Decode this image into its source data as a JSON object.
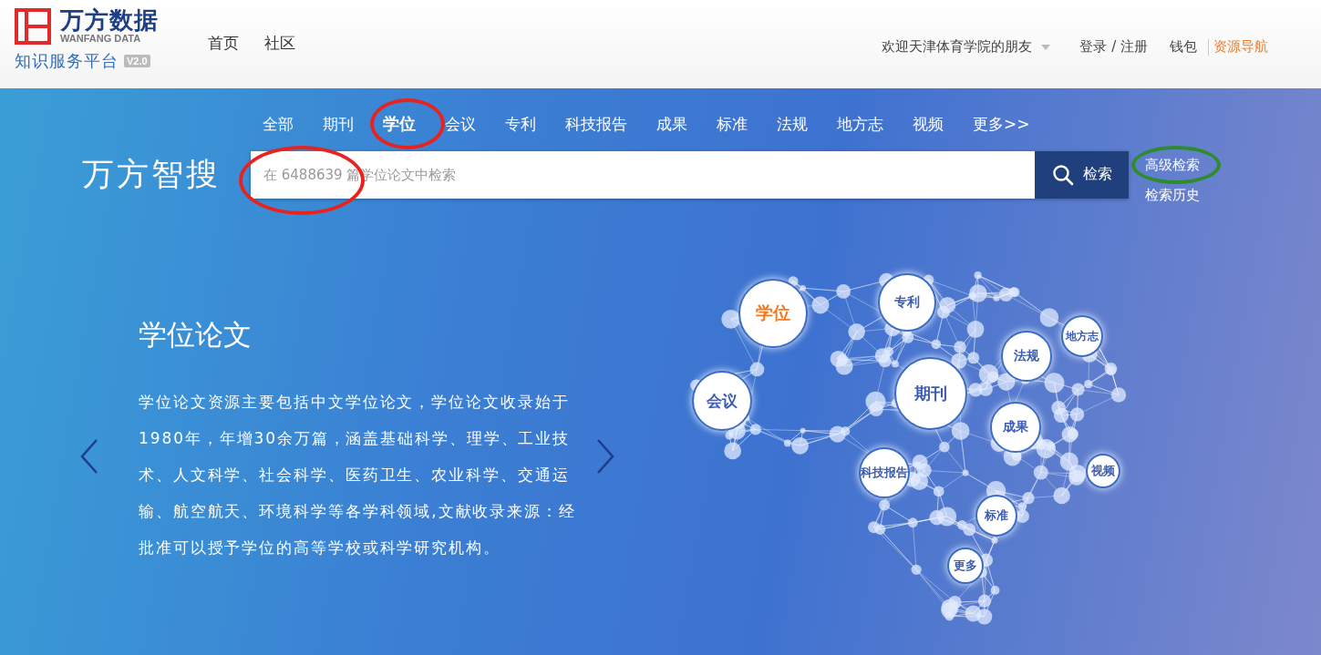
{
  "header": {
    "logo": {
      "brand": "万方数据",
      "brand_en": "WANFANG DATA",
      "platform": "知识服务平台",
      "version": "V2.0"
    },
    "nav": [
      "首页",
      "社区"
    ],
    "welcome": "欢迎天津体育学院的朋友",
    "login": "登录 / 注册",
    "wallet": "钱包",
    "resource_nav": "资源导航"
  },
  "tabs": [
    {
      "label": "全部",
      "selected": false
    },
    {
      "label": "期刊",
      "selected": false
    },
    {
      "label": "学位",
      "selected": true
    },
    {
      "label": "会议",
      "selected": false
    },
    {
      "label": "专利",
      "selected": false
    },
    {
      "label": "科技报告",
      "selected": false
    },
    {
      "label": "成果",
      "selected": false
    },
    {
      "label": "标准",
      "selected": false
    },
    {
      "label": "法规",
      "selected": false
    },
    {
      "label": "地方志",
      "selected": false
    },
    {
      "label": "视频",
      "selected": false
    },
    {
      "label": "更多>>",
      "selected": false
    }
  ],
  "search": {
    "brand": "万方智搜",
    "placeholder": "在 6488639 篇学位论文中检索",
    "button": "检索",
    "advanced": "高级检索",
    "history": "检索历史"
  },
  "intro": {
    "title": "学位论文",
    "text": "学位论文资源主要包括中文学位论文，学位论文收录始于1980年，年增30余万篇，涵盖基础科学、理学、工业技术、人文科学、社会科学、医药卫生、农业科学、交通运输、航空航天、环境科学等各学科领域,文献收录来源：经批准可以授予学位的高等学校或科学研究机构。"
  },
  "bubbles": [
    {
      "label": "学位",
      "selected": true
    },
    {
      "label": "专利",
      "selected": false
    },
    {
      "label": "地方志",
      "selected": false
    },
    {
      "label": "法规",
      "selected": false
    },
    {
      "label": "期刊",
      "selected": false
    },
    {
      "label": "会议",
      "selected": false
    },
    {
      "label": "成果",
      "selected": false
    },
    {
      "label": "科技报告",
      "selected": false
    },
    {
      "label": "视频",
      "selected": false
    },
    {
      "label": "标准",
      "selected": false
    },
    {
      "label": "更多",
      "selected": false
    }
  ],
  "annotations": [
    {
      "color": "#e8231f"
    },
    {
      "color": "#e8231f"
    },
    {
      "color": "#2e8b2e"
    }
  ]
}
